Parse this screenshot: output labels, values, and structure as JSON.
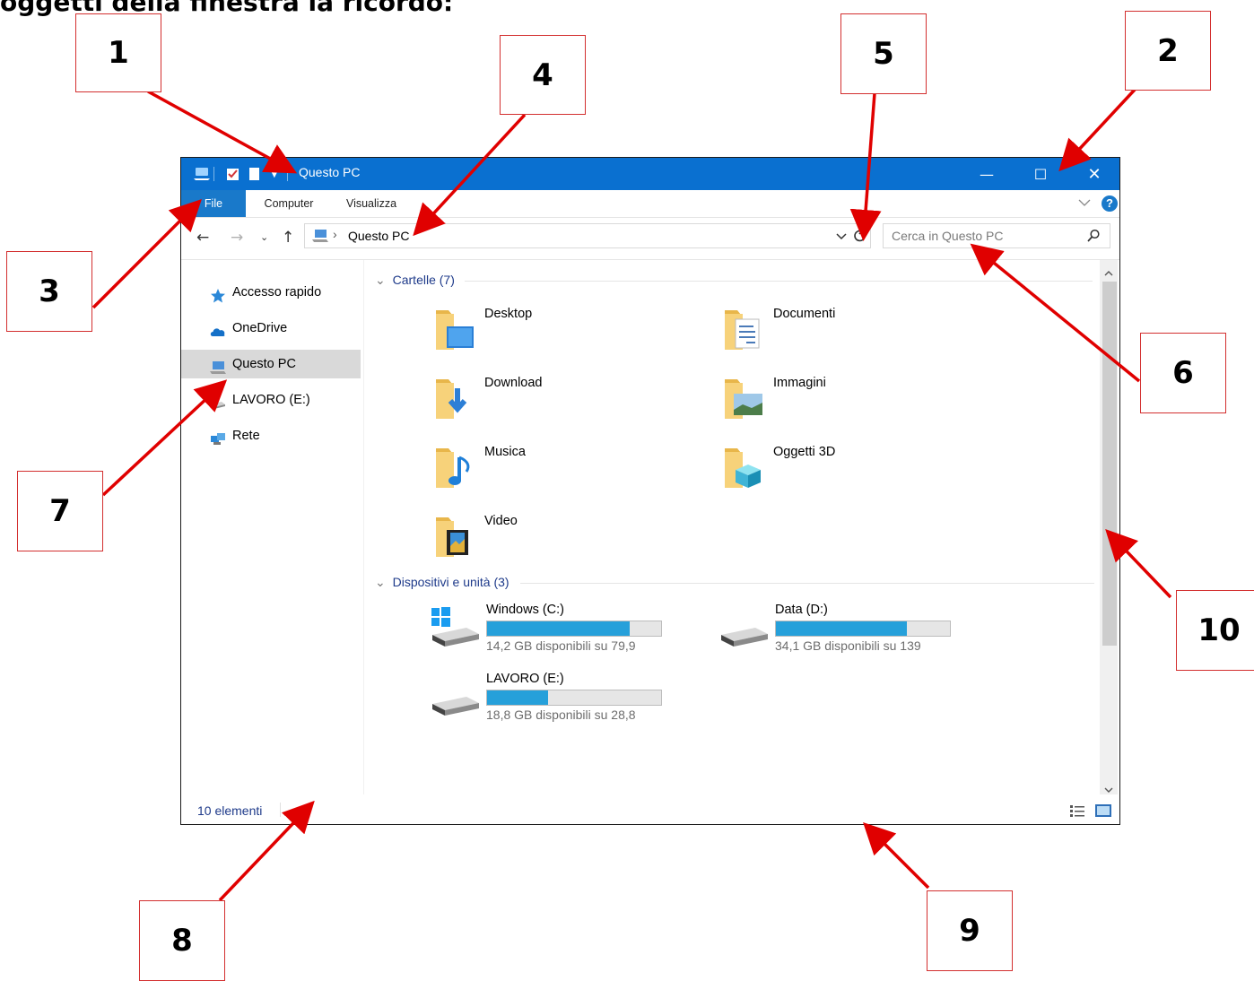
{
  "page_header": "oggetti della finestra la ricordo:",
  "window": {
    "title": "Questo PC",
    "controls": {
      "minimize": "—",
      "maximize": "☐",
      "close": "✕"
    }
  },
  "ribbon": {
    "tabs": [
      {
        "label": "File"
      },
      {
        "label": "Computer"
      },
      {
        "label": "Visualizza"
      }
    ],
    "help": "?"
  },
  "address_bar": {
    "path": "Questo PC",
    "separator": "›"
  },
  "search": {
    "placeholder": "Cerca in Questo PC"
  },
  "navigation_pane": {
    "items": [
      {
        "label": "Accesso rapido",
        "icon": "star-icon"
      },
      {
        "label": "OneDrive",
        "icon": "cloud-icon"
      },
      {
        "label": "Questo PC",
        "icon": "computer-icon",
        "selected": true
      },
      {
        "label": "LAVORO (E:)",
        "icon": "drive-icon"
      },
      {
        "label": "Rete",
        "icon": "network-icon"
      }
    ]
  },
  "groups": {
    "folders": {
      "header": "Cartelle (7)",
      "items": [
        {
          "label": "Desktop",
          "icon": "desktop-folder-icon"
        },
        {
          "label": "Documenti",
          "icon": "documents-folder-icon"
        },
        {
          "label": "Download",
          "icon": "download-folder-icon"
        },
        {
          "label": "Immagini",
          "icon": "pictures-folder-icon"
        },
        {
          "label": "Musica",
          "icon": "music-folder-icon"
        },
        {
          "label": "Oggetti 3D",
          "icon": "3d-objects-folder-icon"
        },
        {
          "label": "Video",
          "icon": "video-folder-icon"
        }
      ]
    },
    "devices": {
      "header": "Dispositivi e unità (3)",
      "items": [
        {
          "label": "Windows (C:)",
          "free_text": "14,2 GB disponibili su 79,9",
          "used_fraction": 0.82
        },
        {
          "label": "Data (D:)",
          "free_text": "34,1 GB disponibili su 139",
          "used_fraction": 0.75
        },
        {
          "label": "LAVORO (E:)",
          "free_text": "18,8 GB disponibili su 28,8",
          "used_fraction": 0.35
        }
      ]
    }
  },
  "status_bar": {
    "count": "10 elementi"
  },
  "callouts": [
    "1",
    "2",
    "3",
    "4",
    "5",
    "6",
    "7",
    "8",
    "9",
    "10"
  ],
  "colors": {
    "titlebar": "#0a70d0",
    "file_tab": "#1979ca",
    "progress": "#26a0da",
    "callout_border": "#d32f2f",
    "arrow": "#e00000"
  }
}
